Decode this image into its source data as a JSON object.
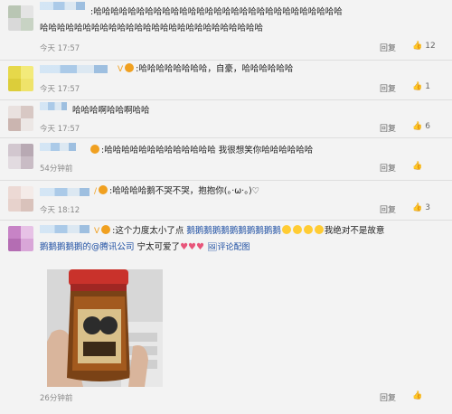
{
  "comments": [
    {
      "text_line1": ":哈哈哈哈哈哈哈哈哈哈哈哈哈哈哈哈哈哈哈哈哈哈哈哈哈哈哈哈哈",
      "text_line2": "哈哈哈哈哈哈哈哈哈哈哈哈哈哈哈哈哈哈哈哈哈哈哈哈哈哈",
      "time": "今天 17:57",
      "reply": "回复",
      "likes": "12"
    },
    {
      "text": ":哈哈哈哈哈哈哈哈，自豪，哈哈哈哈哈哈",
      "time": "今天 17:57",
      "reply": "回复",
      "likes": "1"
    },
    {
      "text": "哈哈哈啊哈哈啊哈哈",
      "time": "今天 17:57",
      "reply": "回复",
      "likes": "6"
    },
    {
      "text": ":哈哈哈哈哈哈哈哈哈哈哈哈哈 我很想笑你哈哈哈哈哈哈",
      "time": "54分钟前",
      "reply": "回复",
      "likes": ""
    },
    {
      "text_prefix": ":哈哈哈哈鹅不哭不哭，",
      "text_link": "抱抱你(。·ω·。)♡",
      "time": "今天 18:12",
      "reply": "回复",
      "likes": "3"
    },
    {
      "text_a": ":这个力度太小了点",
      "text_b": "鹅鹅鹅鹅鹅鹅鹅鹅鹅鹅鹅",
      "text_c": "我绝对不是故意",
      "text_line2_a": "鹅鹅鹅鹅鹅的@腾讯公司",
      "text_line2_b": "宁太可爱了",
      "image_link": "评论配图",
      "time": "26分钟前",
      "reply": "回复",
      "likes": ""
    }
  ],
  "icons": {
    "like": "thumbs-up-icon",
    "verified": "verified-badge-icon"
  },
  "colors": {
    "link": "#1e4fa3",
    "time": "#8a8a8a",
    "heart": "#e8557a"
  }
}
